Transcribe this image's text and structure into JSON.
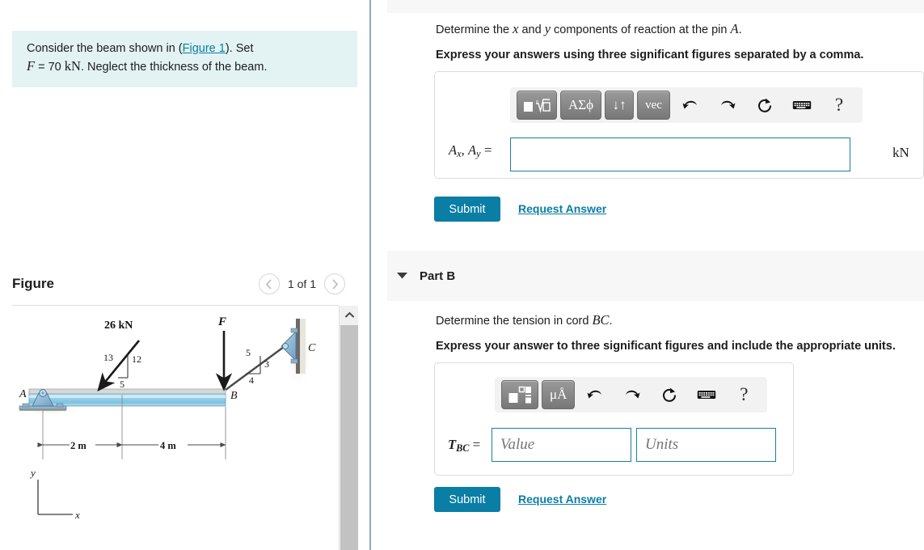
{
  "left": {
    "intro": {
      "line1_pre": "Consider the beam shown in (",
      "link": "Figure 1",
      "line1_post": "). Set",
      "line2_var": "F",
      "line2_eq": "= 70",
      "line2_unit": "kN",
      "line2_rest": ". Neglect the thickness of the beam."
    },
    "figure": {
      "title": "Figure",
      "pager_label": "1 of 1",
      "prev_icon": "chevron-left-icon",
      "next_icon": "chevron-right-icon",
      "scroll_up_icon": "chevron-up-icon"
    },
    "diagram": {
      "load_label": "26 kN",
      "force_label": "F",
      "point_a": "A",
      "point_b": "B",
      "point_c": "C",
      "tri_left_hyp": "13",
      "tri_left_vert": "12",
      "tri_left_horz": "5",
      "tri_right_hyp": "5",
      "tri_right_vert": "3",
      "tri_right_horz": "4",
      "dim_left": "2 m",
      "dim_right": "4 m",
      "axis_y": "y",
      "axis_x": "x",
      "beam_color": "#8ecae6",
      "support_color": "#7fa8c9"
    }
  },
  "right": {
    "partA": {
      "question": "Determine the ",
      "question_var1": "x",
      "question_mid": " and ",
      "question_var2": "y",
      "question_tail": " components of reaction at the pin ",
      "question_var3": "A",
      "question_period": ".",
      "instruction": "Express your answers using three significant figures separated by a comma.",
      "toolbar": [
        {
          "name": "math-template-button",
          "label": "■√□"
        },
        {
          "name": "greek-symbols-button",
          "label": "ΑΣϕ"
        },
        {
          "name": "sort-order-button",
          "label": "↓↑"
        },
        {
          "name": "vector-button",
          "label": "vec"
        },
        {
          "name": "undo-icon",
          "label": "↶"
        },
        {
          "name": "redo-icon",
          "label": "↷"
        },
        {
          "name": "reset-icon",
          "label": "↻"
        },
        {
          "name": "keyboard-icon",
          "label": "⌨"
        },
        {
          "name": "help-icon",
          "label": "?"
        }
      ],
      "answer_label_a": "A",
      "answer_label_a_sub": "x",
      "answer_label_b": "A",
      "answer_label_b_sub": "y",
      "answer_label_eq": "=",
      "answer_value": "",
      "answer_unit": "kN",
      "submit_label": "Submit",
      "request_label": "Request Answer"
    },
    "partB": {
      "header_title": "Part B",
      "caret_icon": "caret-down-icon",
      "question": "Determine the tension in cord ",
      "question_var": "BC",
      "question_period": ".",
      "instruction": "Express your answer to three significant figures and include the appropriate units.",
      "toolbar": [
        {
          "name": "math-template-button",
          "label": "■□"
        },
        {
          "name": "units-symbols-button",
          "label": "μÅ"
        },
        {
          "name": "undo-icon",
          "label": "↶"
        },
        {
          "name": "redo-icon",
          "label": "↷"
        },
        {
          "name": "reset-icon",
          "label": "↻"
        },
        {
          "name": "keyboard-icon",
          "label": "⌨"
        },
        {
          "name": "help-icon",
          "label": "?"
        }
      ],
      "answer_label": "T",
      "answer_label_sub": "BC",
      "answer_label_eq": "=",
      "value_placeholder": "Value",
      "units_placeholder": "Units",
      "submit_label": "Submit",
      "request_label": "Request Answer"
    }
  },
  "colors": {
    "accent": "#0a7ea4",
    "intro_bg": "#e3f3f3",
    "panel_header_bg": "#f7f7f7",
    "input_border": "#1b7f9e"
  }
}
